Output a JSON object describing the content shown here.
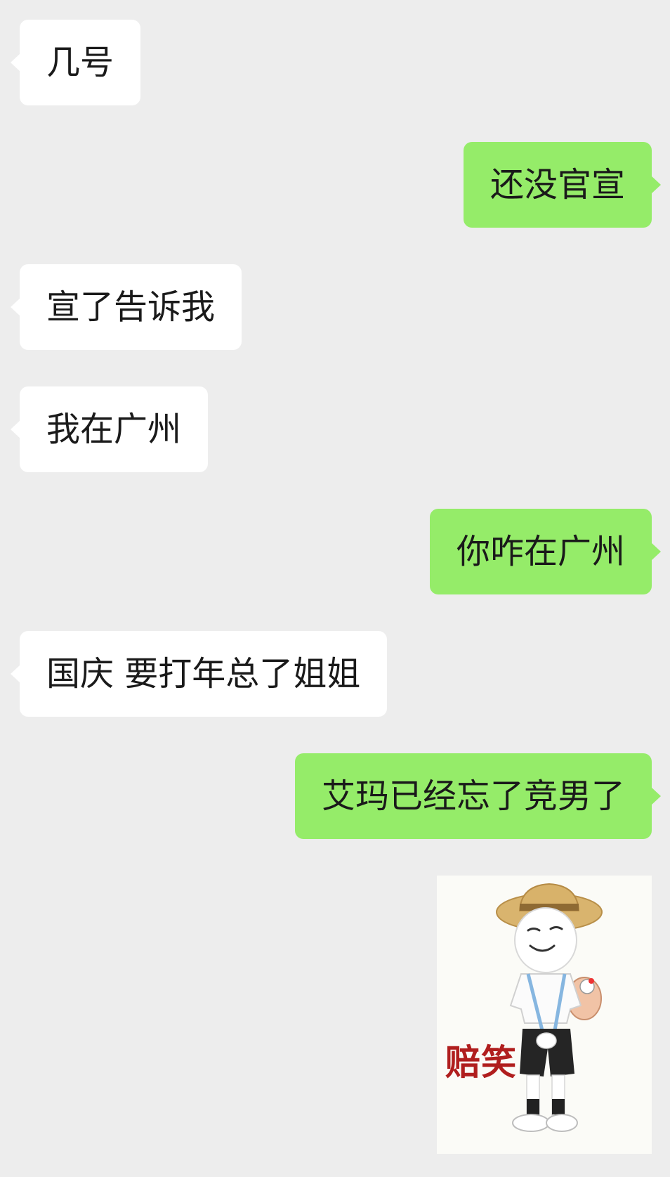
{
  "messages": [
    {
      "side": "in",
      "text": "几号"
    },
    {
      "side": "out",
      "text": "还没官宣"
    },
    {
      "side": "in",
      "text": "宣了告诉我"
    },
    {
      "side": "in",
      "text": "我在广州"
    },
    {
      "side": "out",
      "text": "你咋在广州"
    },
    {
      "side": "in",
      "text": "国庆 要打年总了姐姐"
    },
    {
      "side": "out",
      "text": "艾玛已经忘了竞男了"
    }
  ],
  "sticker": {
    "caption": "赔笑",
    "icon": "smiling-figure-with-straw-hat-sticker",
    "caption_color": "#b01e1e"
  },
  "colors": {
    "background": "#ededed",
    "incoming_bubble": "#ffffff",
    "outgoing_bubble": "#95ec69"
  }
}
